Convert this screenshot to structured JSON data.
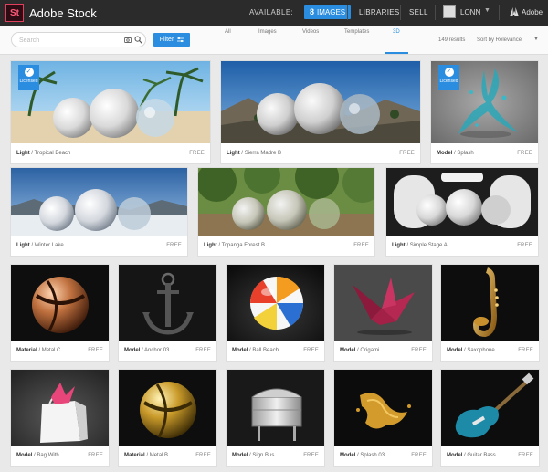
{
  "app": {
    "logo": "St",
    "brand": "Adobe Stock"
  },
  "nav": {
    "available_label": "AVAILABLE:",
    "images_count": "8",
    "images_label": "IMAGES",
    "libraries": "LIBRARIES",
    "sell": "SELL",
    "user": "LONN",
    "adobe": "Adobe"
  },
  "search": {
    "placeholder": "Search",
    "filter_label": "Filter"
  },
  "tabs": [
    {
      "label": "All",
      "active": false
    },
    {
      "label": "Images",
      "active": false
    },
    {
      "label": "Videos",
      "active": false
    },
    {
      "label": "Templates",
      "active": false
    },
    {
      "label": "3D",
      "active": true
    }
  ],
  "results_text": "149 results",
  "sort_label": "Sort by Relevance",
  "licensed_label": "Licensed",
  "items": [
    {
      "category": "Light",
      "title": "Tropical Beach",
      "price": "FREE",
      "licensed": true
    },
    {
      "category": "Light",
      "title": "Sierra Madre B",
      "price": "FREE",
      "licensed": false
    },
    {
      "category": "Model",
      "title": "Splash",
      "price": "FREE",
      "licensed": true
    },
    {
      "category": "Light",
      "title": "Winter Lake",
      "price": "FREE",
      "licensed": false
    },
    {
      "category": "Light",
      "title": "Topanga Forest B",
      "price": "FREE",
      "licensed": false
    },
    {
      "category": "Light",
      "title": "Simple Stage A",
      "price": "FREE",
      "licensed": false
    },
    {
      "category": "Material",
      "title": "Metal C",
      "price": "FREE",
      "licensed": false
    },
    {
      "category": "Model",
      "title": "Anchor 03",
      "price": "FREE",
      "licensed": false
    },
    {
      "category": "Model",
      "title": "Ball Beach",
      "price": "FREE",
      "licensed": false
    },
    {
      "category": "Model",
      "title": "Origami ...",
      "price": "FREE",
      "licensed": false
    },
    {
      "category": "Model",
      "title": "Saxophone",
      "price": "FREE",
      "licensed": false
    },
    {
      "category": "Model",
      "title": "Bag With...",
      "price": "FREE",
      "licensed": false
    },
    {
      "category": "Material",
      "title": "Metal B",
      "price": "FREE",
      "licensed": false
    },
    {
      "category": "Model",
      "title": "Sign Bus ...",
      "price": "FREE",
      "licensed": false
    },
    {
      "category": "Model",
      "title": "Splash 03",
      "price": "FREE",
      "licensed": false
    },
    {
      "category": "Model",
      "title": "Guitar Bass",
      "price": "FREE",
      "licensed": false
    }
  ],
  "colors": {
    "accent": "#2a8de0",
    "topbar": "#2b2b2b",
    "background": "#e9e9e9"
  }
}
